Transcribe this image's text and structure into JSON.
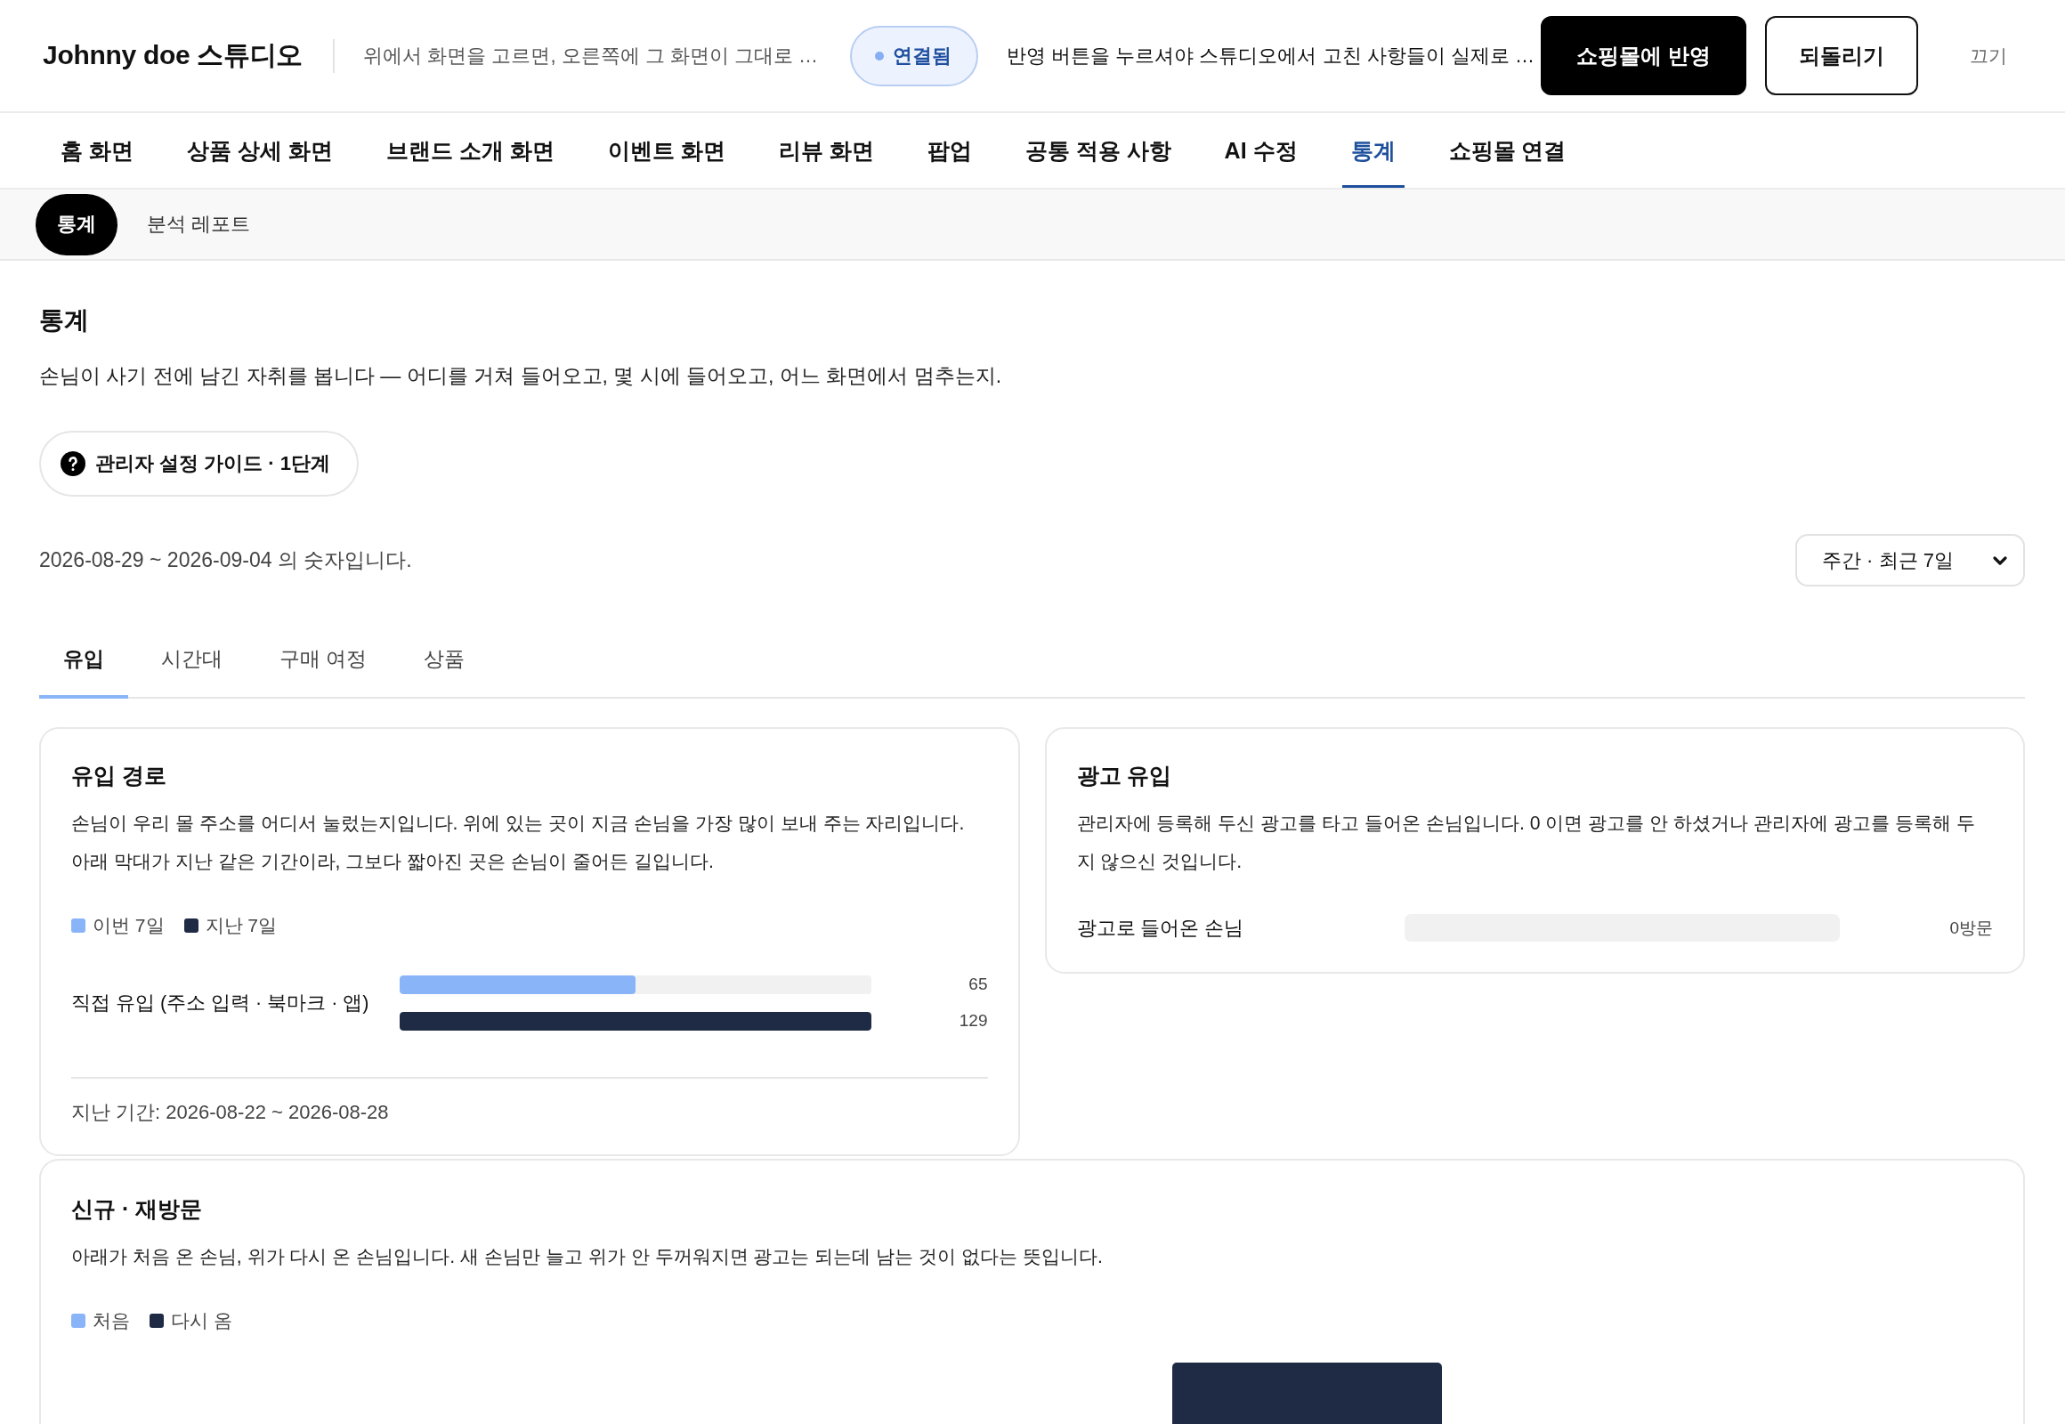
{
  "header": {
    "title": "Johnny doe 스튜디오",
    "hint": "위에서 화면을 고르면, 오른쪽에 그 화면이 그대로 …",
    "status": {
      "label": "연결됨",
      "connected": true
    },
    "notice": "반영 버튼을 누르셔야 스튜디오에서 고친 사항들이 실제로 …",
    "buttons": [
      {
        "label": "쇼핑몰에 반영",
        "kind": "primary"
      },
      {
        "label": "되돌리기",
        "kind": "outline"
      },
      {
        "label": "끄기",
        "kind": "plain"
      }
    ]
  },
  "nav_tabs": [
    {
      "label": "홈 화면",
      "selected": false
    },
    {
      "label": "상품 상세 화면",
      "selected": false
    },
    {
      "label": "브랜드 소개 화면",
      "selected": false
    },
    {
      "label": "이벤트 화면",
      "selected": false
    },
    {
      "label": "리뷰 화면",
      "selected": false
    },
    {
      "label": "팝업",
      "selected": false
    },
    {
      "label": "공통 적용 사항",
      "selected": false
    },
    {
      "label": "AI 수정",
      "selected": false
    },
    {
      "label": "통계",
      "selected": true
    },
    {
      "label": "쇼핑몰 연결",
      "selected": false
    }
  ],
  "sub_tabs": [
    {
      "label": "통계",
      "selected": true
    },
    {
      "label": "분석 레포트",
      "selected": false
    }
  ],
  "page": {
    "title": "통계",
    "description": "손님이 사기 전에 남긴 자취를 봅니다 — 어디를 거쳐 들어오고, 몇 시에 들어오고, 어느 화면에서 멈추는지.",
    "guide_button": "관리자 설정 가이드 · 1단계",
    "range_text": "2026-08-29 ~ 2026-09-04 의 숫자입니다.",
    "period_select": {
      "value": "주간 · 최근 7일"
    }
  },
  "section_tabs": [
    {
      "label": "유입",
      "selected": true
    },
    {
      "label": "시간대",
      "selected": false
    },
    {
      "label": "구매 여정",
      "selected": false
    },
    {
      "label": "상품",
      "selected": false
    }
  ],
  "cards": [
    {
      "kind": "comparison",
      "title": "유입 경로",
      "description": "손님이 우리 몰 주소를 어디서 눌렀는지입니다. 위에 있는 곳이 지금 손님을 가장 많이 보내 주는 자리입니다. 아래 막대가 지난 같은 기간이라, 그보다 짧아진 곳은 손님이 줄어든 길입니다.",
      "legend": [
        {
          "label": "이번 7일",
          "color": "#8ab4f8"
        },
        {
          "label": "지난 7일",
          "color": "#1f2a44"
        }
      ],
      "rows": [
        {
          "label": "직접 유입 (주소 입력 · 북마크 · 앱)",
          "bars": [
            {
              "level": 0.5,
              "reading": "65"
            },
            {
              "level": 1,
              "reading": "129"
            }
          ]
        }
      ],
      "footer": "지난 기간: 2026-08-22 ~ 2026-08-28"
    },
    {
      "kind": "meter",
      "title": "광고 유입",
      "description": "관리자에 등록해 두신 광고를 타고 들어온 손님입니다. 0 이면 광고를 안 하셨거나 관리자에 광고를 등록해 두지 않으신 것입니다.",
      "rows": [
        {
          "label": "광고로 들어온 손님",
          "level": 0,
          "reading": "0방문"
        }
      ]
    },
    {
      "kind": "stacked",
      "title": "신규 · 재방문",
      "description": "아래가 처음 온 손님, 위가 다시 온 손님입니다. 새 손님만 늘고 위가 안 두꺼워지면 광고는 되는데 남는 것이 없다는 뜻입니다.",
      "legend": [
        {
          "label": "처음",
          "color": "#8ab4f8"
        },
        {
          "label": "다시 옴",
          "color": "#1f2a44"
        }
      ]
    }
  ]
}
